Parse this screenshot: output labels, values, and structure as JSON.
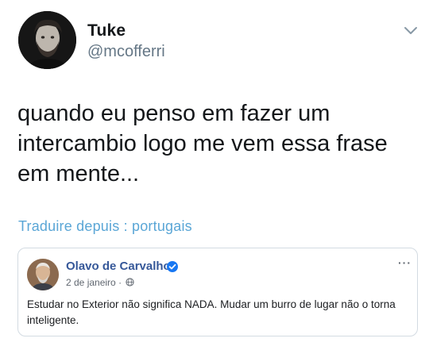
{
  "tweet": {
    "author": {
      "display_name": "Tuke",
      "handle": "@mcofferri",
      "avatar_icon": "user-avatar"
    },
    "menu_icon": "chevron-down-icon",
    "text_lines": [
      "quando eu penso em fazer um",
      "intercambio logo me vem essa frase",
      "em mente..."
    ],
    "translate_link": "Traduire depuis : portugais"
  },
  "quoted_post": {
    "author_name": "Olavo de Carvalho",
    "verified_icon": "verified-badge-icon",
    "date": "2 de janeiro",
    "separator": "·",
    "audience_icon": "globe-icon",
    "more_icon": "more-options-icon",
    "more_label": "···",
    "text": "Estudar no Exterior não significa NADA. Mudar um burro de lugar não o torna inteligente."
  },
  "colors": {
    "name_text": "#14171a",
    "handle_text": "#657786",
    "translate_link": "#5aa6d6",
    "fb_name": "#365899",
    "fb_verified": "#1877f2",
    "card_border": "#d3dbe2"
  }
}
